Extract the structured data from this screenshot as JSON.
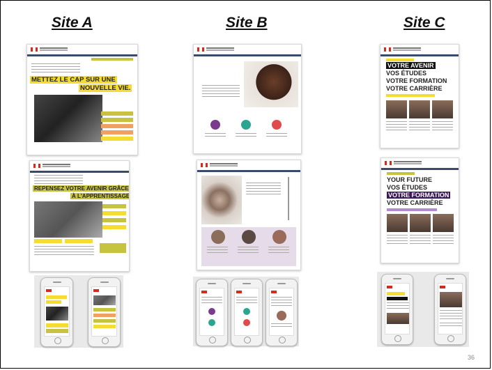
{
  "sites": [
    {
      "title": "Site A"
    },
    {
      "title": "Site B"
    },
    {
      "title": "Site C"
    }
  ],
  "site_a": {
    "page1_headline_line1": "METTEZ LE CAP SUR UNE",
    "page1_headline_line2": "NOUVELLE VIE.",
    "page2_headline_line1": "REPENSEZ VOTRE AVENIR GRÂCE",
    "page2_headline_line2": "À L'APPRENTISSAGE"
  },
  "site_c": {
    "page1_lines": [
      "VOTRE AVENIR",
      "VOS ÉTUDES",
      "VOTRE FORMATION",
      "VOTRE CARRIÈRE"
    ],
    "page2_lines": [
      "YOUR FUTURE",
      "VOS ÉTUDES",
      "VOTRE FORMATION",
      "VOTRE CARRIÈRE"
    ]
  },
  "page_number": "36",
  "colors": {
    "accent_yellow": "#f4dc30",
    "accent_olive": "#c6c341",
    "gov_blue": "#3a4a6a",
    "canada_red": "#d52b1e",
    "purple": "#3b1a5a"
  }
}
